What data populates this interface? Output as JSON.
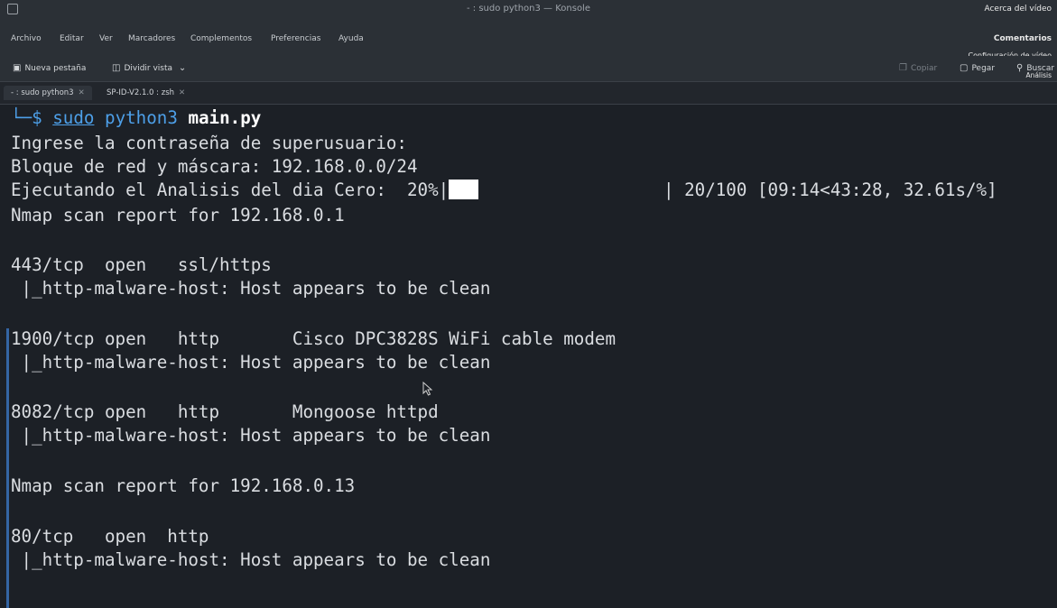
{
  "window": {
    "title": "- : sudo python3 — Konsole"
  },
  "overlay": {
    "about_video": "Acerca del vídeo",
    "comments": "Comentarios",
    "video_settings": "Configuración de vídeo",
    "analysis": "Análisis"
  },
  "menu": [
    "Archivo",
    "Editar",
    "Ver",
    "Marcadores",
    "Complementos",
    "Preferencias",
    "Ayuda"
  ],
  "toolbar": {
    "new_tab": "Nueva pestaña",
    "split_view": "Dividir vista",
    "copy": "Copiar",
    "paste": "Pegar",
    "search": "Buscar"
  },
  "tabs": [
    {
      "label": "- : sudo python3",
      "active": true
    },
    {
      "label": "SP-ID-V2.1.0 : zsh",
      "active": false
    }
  ],
  "terminal": {
    "prompt_corner": "└─",
    "prompt_symbol": "$",
    "cmd_sudo": "sudo",
    "cmd_python": "python3",
    "cmd_script": "main.py",
    "lines": {
      "password": "Ingrese la contraseña de superusuario:",
      "netblock": "Bloque de red y máscara: 192.168.0.0/24",
      "progress_prefix": "Ejecutando el Analisis del dia Cero:  20%|",
      "progress_suffix": "| 20/100 [09:14<43:28, 32.61s/%]",
      "report1": "Nmap scan report for 192.168.0.1",
      "p443": "443/tcp  open   ssl/https",
      "p443_script": " |_http-malware-host: Host appears to be clean",
      "p1900": "1900/tcp open   http       Cisco DPC3828S WiFi cable modem",
      "p1900_script": " |_http-malware-host: Host appears to be clean",
      "p8082": "8082/tcp open   http       Mongoose httpd",
      "p8082_script": " |_http-malware-host: Host appears to be clean",
      "report2": "Nmap scan report for 192.168.0.13",
      "p80": "80/tcp   open  http",
      "p80_script": " |_http-malware-host: Host appears to be clean"
    },
    "progress_percent": 20
  },
  "colors": {
    "background": "#1c2026",
    "prompt": "#4d9fe8",
    "text": "#dadde1",
    "marker": "#3465a4"
  }
}
